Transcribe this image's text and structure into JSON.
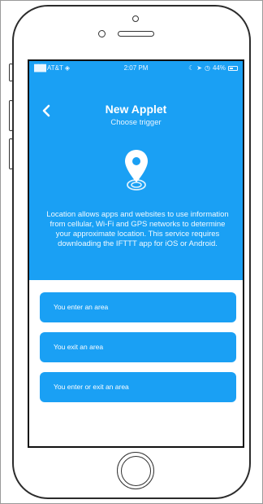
{
  "status_bar": {
    "carrier": "AT&T",
    "time": "2:07 PM",
    "battery": "44%"
  },
  "header": {
    "title": "New Applet",
    "subtitle": "Choose trigger",
    "description": "Location allows apps and websites to use information from cellular, Wi-Fi and GPS networks to determine your approximate location. This service requires downloading the IFTTT app for iOS or Android.",
    "icon": "location-pin-icon"
  },
  "options": [
    {
      "label": "You enter an area"
    },
    {
      "label": "You exit an area"
    },
    {
      "label": "You enter or exit an area"
    }
  ],
  "colors": {
    "accent": "#1aa0f4",
    "text_on_accent": "#ffffff"
  }
}
